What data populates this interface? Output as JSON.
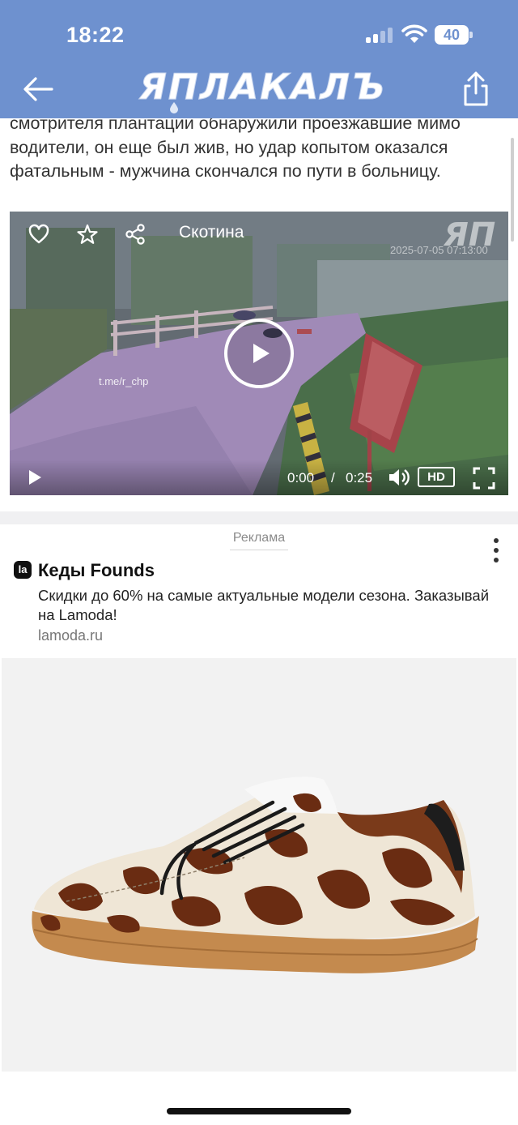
{
  "status_bar": {
    "time": "18:22",
    "battery": "40"
  },
  "header": {
    "logo": "ЯПЛАКАЛЪ",
    "back_icon": "arrow-left-icon",
    "share_icon": "share-icon",
    "background_color": "#6e91cf"
  },
  "article": {
    "text": "смотрителя плантации обнаружили проезжавшие мимо водители, он еще был жив, но удар копытом оказался фатальным - мужчина скончался по пути в больницу."
  },
  "video": {
    "title": "Скотина",
    "watermark": "ЯП",
    "overlay_timestamp": "2025-07-05 07:13:00",
    "overlay_channel": "t.me/r_chp",
    "current_time": "0:00",
    "separator": "/",
    "duration": "0:25",
    "quality": "HD",
    "icons": [
      "heart-icon",
      "star-icon",
      "share-nodes-icon",
      "play-icon",
      "volume-icon",
      "fullscreen-icon"
    ]
  },
  "ad": {
    "label": "Реклама",
    "logo_text": "la",
    "title": "Кеды Founds",
    "text": "Скидки до 60% на самые актуальные модели сезона. Заказывай на Lamoda!",
    "domain": "lamoda.ru",
    "image_subject": "cow-print-sneaker"
  }
}
